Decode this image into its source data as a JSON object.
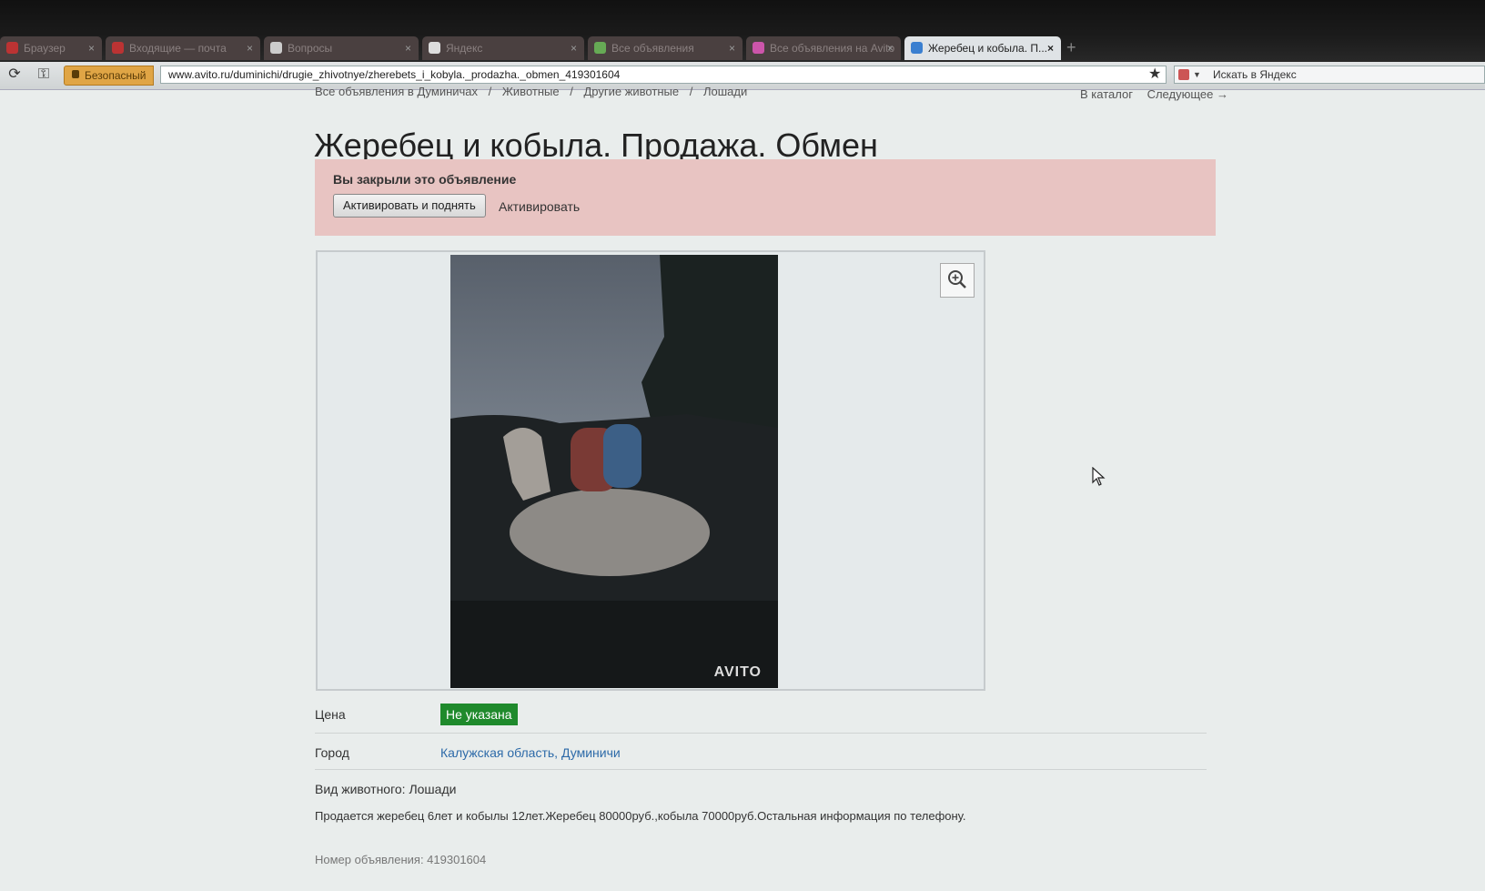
{
  "browser": {
    "tabs": [
      {
        "label": "Браузер",
        "active": false
      },
      {
        "label": "Входящие — почта",
        "active": false
      },
      {
        "label": "Вопросы",
        "active": false
      },
      {
        "label": "Яндекс",
        "active": false
      },
      {
        "label": "Все объявления",
        "active": false
      },
      {
        "label": "Все объявления на Avito",
        "active": false
      },
      {
        "label": "Жеребец и кобыла. П...",
        "active": true
      }
    ],
    "security_label": "Безопасный",
    "url": "www.avito.ru/duminichi/drugie_zhivotnye/zherebets_i_kobyla._prodazha._obmen_419301604",
    "search_placeholder": "Искать в Яндекс"
  },
  "breadcrumb": [
    "Все объявления в Думиничах",
    "/",
    "Животные",
    "/",
    "Другие животные",
    "/",
    "Лошади"
  ],
  "nav_right": {
    "catalog": "В каталог",
    "next": "Следующее →"
  },
  "title": "Жеребец и кобыла. Продажа. Обмен",
  "banner": {
    "message": "Вы закрыли это объявление",
    "activate_raise": "Активировать и поднять",
    "activate": "Активировать",
    "color": "#e8c4c2"
  },
  "photo": {
    "watermark": "AVITO"
  },
  "props": {
    "price_label": "Цена",
    "price_value": "Не указана",
    "city_label": "Город",
    "city_value": "Калужская область, Думиничи",
    "animal_type": "Вид животного: Лошади",
    "description": "Продается жеребец 6лет и кобылы 12лет.Жеребец 80000руб.,кобыла 70000руб.Остальная информация по телефону.",
    "ad_number": "Номер объявления: 419301604"
  }
}
